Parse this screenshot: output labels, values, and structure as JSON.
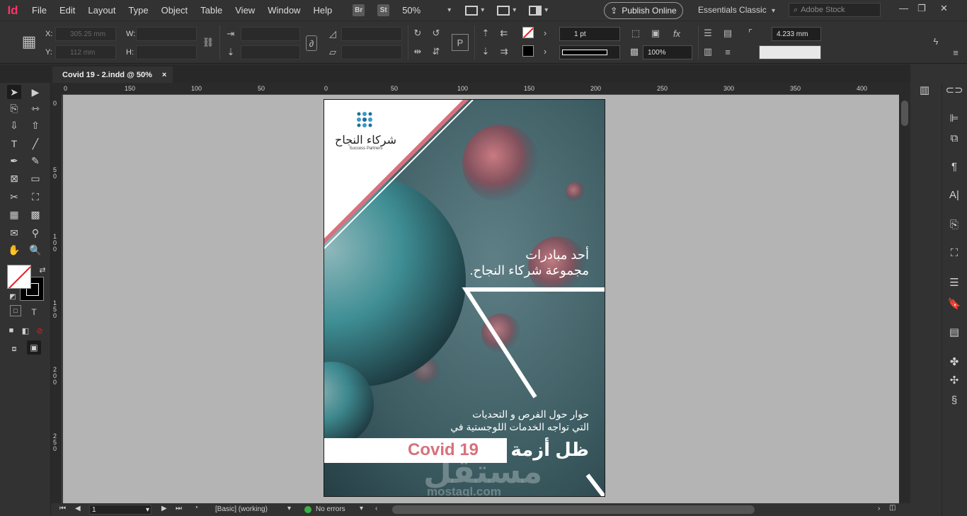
{
  "app": {
    "logo": "Id"
  },
  "menu": [
    "File",
    "Edit",
    "Layout",
    "Type",
    "Object",
    "Table",
    "View",
    "Window",
    "Help"
  ],
  "menubar": {
    "badge_br": "Br",
    "badge_st": "St",
    "zoom": "50%",
    "publish_label": "Publish Online",
    "workspace": "Essentials Classic",
    "stock_placeholder": "Adobe Stock"
  },
  "control": {
    "x_label": "X:",
    "y_label": "Y:",
    "w_label": "W:",
    "h_label": "H:",
    "x_value": "305.25 mm",
    "y_value": "112 mm",
    "stroke_weight": "1 pt",
    "opacity": "100%",
    "offset": "4.233 mm"
  },
  "tab": {
    "title": "Covid 19 - 2.indd @ 50%",
    "close": "×"
  },
  "ruler_h": [
    "0",
    "150",
    "100",
    "50",
    "0",
    "50",
    "100",
    "150",
    "200",
    "250",
    "300",
    "350",
    "400"
  ],
  "ruler_v": [
    "0",
    "50",
    "100",
    "150",
    "200",
    "250"
  ],
  "page": {
    "logo_ar": "شركاء النجاح",
    "logo_en": "Success Partners",
    "headline_line1": "أحد مبادرات",
    "headline_line2": "مجموعة شركاء النجاح.",
    "body_line1": "حوار حول الفرص و التحديات",
    "body_line2": "التي تواجه الخدمات اللوجستية في",
    "crisis": "ظل أزمة",
    "covid": "Covid 19",
    "watermark": "مستقل",
    "watermark_en": "mostaql.com"
  },
  "status": {
    "page_number": "1",
    "style": "[Basic] (working)",
    "errors": "No errors"
  },
  "colors": {
    "accent_pink": "#d9707c",
    "page_bg": "#3f6066",
    "status_ok": "#3cb043"
  }
}
